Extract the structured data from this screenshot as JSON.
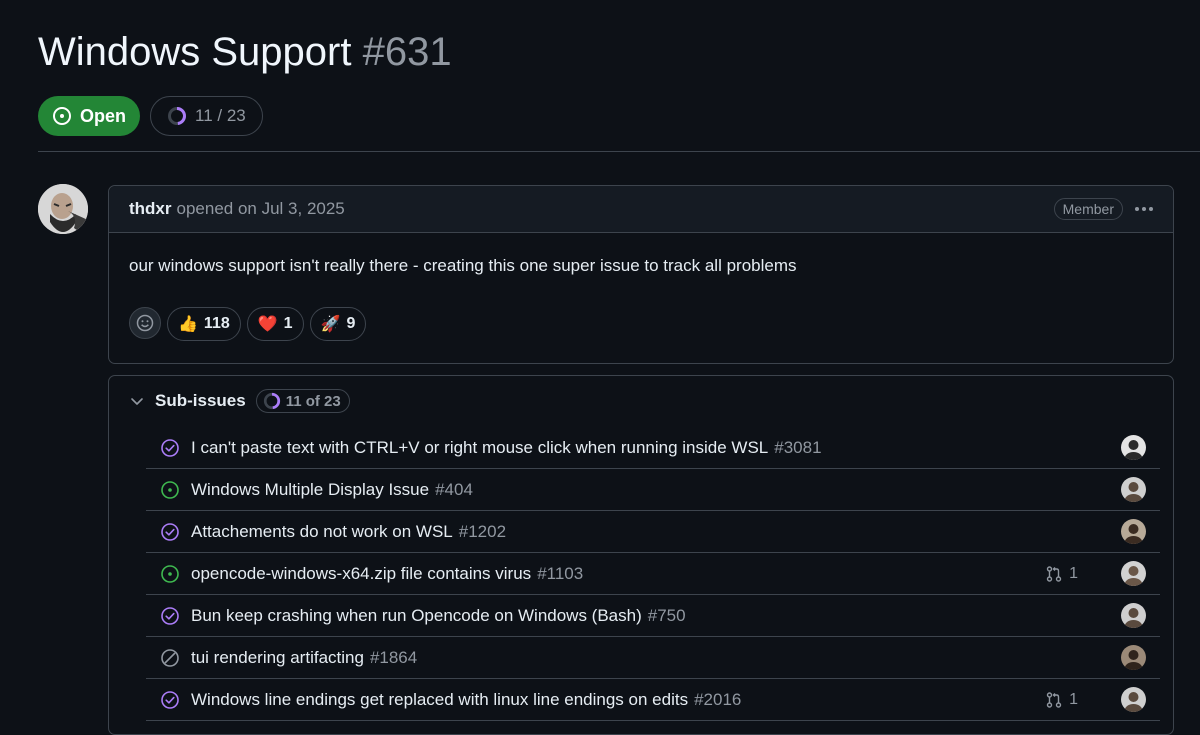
{
  "issue": {
    "title": "Windows Support",
    "number": "#631",
    "state": "Open",
    "progress": "11 / 23"
  },
  "comment": {
    "author": "thdxr",
    "opened_text": "opened on Jul 3, 2025",
    "role_badge": "Member",
    "body": "our windows support isn't really there - creating this one super issue to track all problems",
    "reactions": [
      {
        "emoji": "👍",
        "count": "118"
      },
      {
        "emoji": "❤️",
        "count": "1"
      },
      {
        "emoji": "🚀",
        "count": "9"
      }
    ]
  },
  "sub_issues": {
    "heading": "Sub-issues",
    "count": "11 of 23",
    "completed_fraction": 0.478,
    "items": [
      {
        "title": "I can't paste text with CTRL+V or right mouse click when running inside WSL",
        "number": "#3081",
        "status": "closed",
        "linked_prs": ""
      },
      {
        "title": "Windows Multiple Display Issue",
        "number": "#404",
        "status": "open",
        "linked_prs": ""
      },
      {
        "title": "Attachements do not work on WSL",
        "number": "#1202",
        "status": "closed",
        "linked_prs": ""
      },
      {
        "title": "opencode-windows-x64.zip file contains virus",
        "number": "#1103",
        "status": "open",
        "linked_prs": "1"
      },
      {
        "title": "Bun keep crashing when run Opencode on Windows (Bash)",
        "number": "#750",
        "status": "closed",
        "linked_prs": ""
      },
      {
        "title": "tui rendering artifacting",
        "number": "#1864",
        "status": "not-planned",
        "linked_prs": ""
      },
      {
        "title": "Windows line endings get replaced with linux line endings on edits",
        "number": "#2016",
        "status": "closed",
        "linked_prs": "1"
      }
    ]
  },
  "colors": {
    "background": "#0d1117",
    "open_green": "#238636",
    "open_icon": "#3fb950",
    "closed_purple": "#ab7df8",
    "not_planned_gray": "#9198a1",
    "border": "#3d444d",
    "muted_text": "#9198a1"
  },
  "icons": {
    "state": "issue-opened-icon",
    "progress": "progress-ring-icon",
    "add_reaction": "smiley-icon",
    "collapse": "chevron-down-icon",
    "pr": "git-pull-request-icon",
    "more": "kebab-horizontal-icon"
  }
}
